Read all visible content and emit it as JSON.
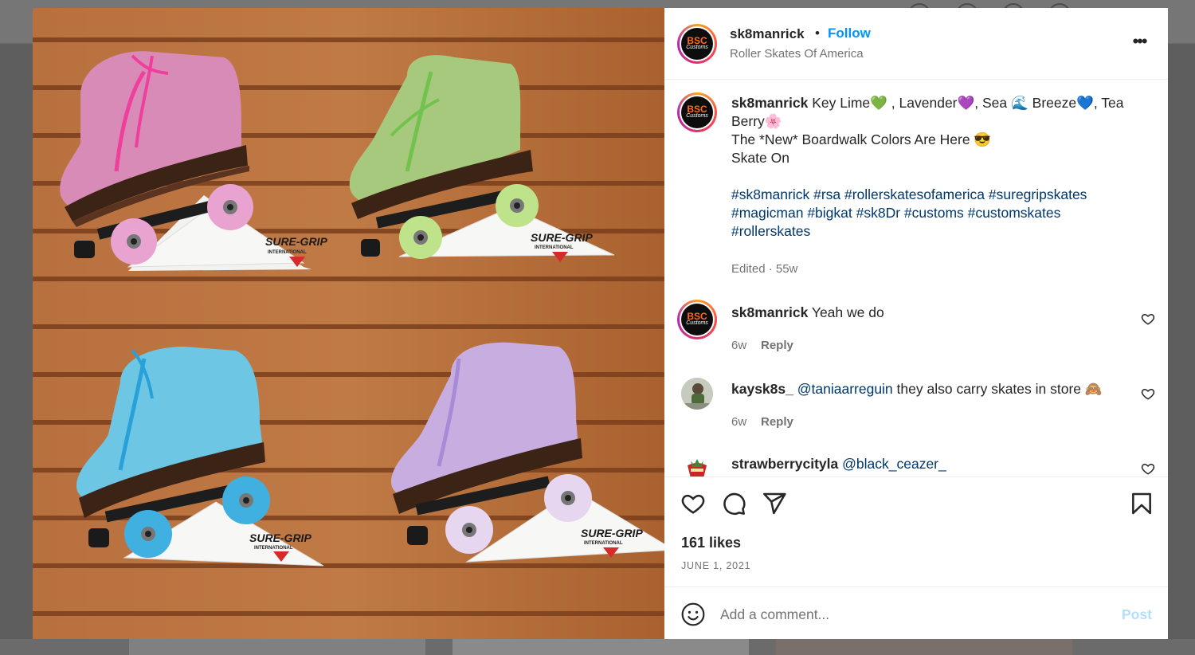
{
  "post": {
    "username": "sk8manrick",
    "follow_label": "Follow",
    "location": "Roller Skates Of America",
    "more_label": "•••",
    "avatar_top": "BSC",
    "avatar_bottom": "Customs",
    "caption_line1": "Key Lime💚 , Lavender💜, Sea 🌊 Breeze💙, Tea Berry🌸",
    "caption_line2": "The *New* Boardwalk Colors Are Here 😎",
    "caption_line3": "Skate On",
    "hashtags": "#sk8manrick #rsa #rollerskatesofamerica #suregripskates #magicman #bigkat #sk8Dr #customs #customskates #rollerskates",
    "meta": "Edited · 55w",
    "likes": "161 likes",
    "date": "JUNE 1, 2021",
    "comment_placeholder": "Add a comment...",
    "post_label": "Post"
  },
  "photo": {
    "brand_top": "SURE-GRIP",
    "brand_bottom": "INTERNATIONAL",
    "colors": {
      "wood": "#b4693a",
      "pink": "#d98bb8",
      "green": "#a7c97e",
      "blue": "#6cc6e4",
      "lavender": "#c8aee0"
    }
  },
  "comments": [
    {
      "user": "sk8manrick",
      "text": "Yeah we do",
      "mention": "",
      "time": "6w",
      "reply": "Reply"
    },
    {
      "user": "kaysk8s_",
      "mention": "@taniaarreguin",
      "text": " they also carry skates in store 🙈",
      "time": "6w",
      "reply": "Reply"
    },
    {
      "user": "strawberrycityla",
      "mention": "@black_ceazer_",
      "text": "",
      "time": "",
      "reply": ""
    }
  ],
  "icons": {
    "like": "heart-icon",
    "comment": "comment-bubble-icon",
    "share": "paper-plane-icon",
    "save": "bookmark-icon",
    "emoji": "smiley-icon",
    "more": "ellipsis-icon"
  }
}
